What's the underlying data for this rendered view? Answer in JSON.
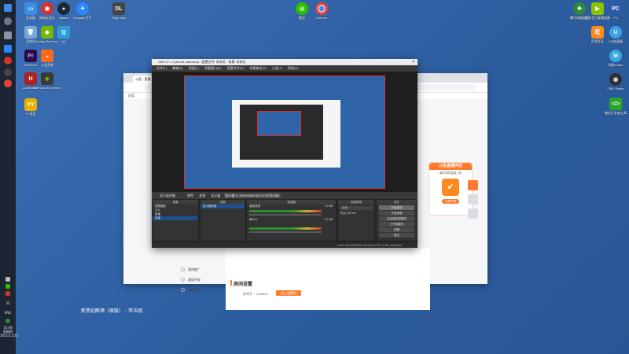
{
  "taskbar": {
    "tray_lang": "ENG",
    "clock_time": "10:48",
    "clock_weekday": "星期四",
    "clock_date": "2021/11/25",
    "tray_num": "35"
  },
  "desktop_left": [
    {
      "label": "此电脑",
      "icon": "computer-icon",
      "color": "#3a8ee6"
    },
    {
      "label": "网易云音乐",
      "icon": "netease-music-icon",
      "color": "#d7322c"
    },
    {
      "label": "Steam",
      "icon": "steam-icon",
      "color": "#1b2838"
    },
    {
      "label": "Dingtalk 钉钉",
      "icon": "dingtalk-icon",
      "color": "#2d88ff"
    },
    {
      "label": "Ding Light",
      "icon": "dl-icon",
      "color": "#444444"
    },
    {
      "label": "回收站",
      "icon": "recycle-bin-icon",
      "color": "#7aa7d8"
    },
    {
      "label": "Nvidia GeForce",
      "icon": "nvidia-icon",
      "color": "#76b900"
    },
    {
      "label": "QQ",
      "icon": "qq-icon",
      "color": "#2d9cdb"
    },
    {
      "label": "Premiere",
      "icon": "premiere-icon",
      "color": "#2a0d4a"
    },
    {
      "label": "斗鱼直播",
      "icon": "douyu-icon",
      "color": "#ff6a1a"
    },
    {
      "label": "AutoHotkey",
      "icon": "autohotkey-icon",
      "color": "#b02222"
    },
    {
      "label": "GeForce Experience",
      "icon": "geforce-icon",
      "color": "#3a3a3a"
    },
    {
      "label": "YY语音",
      "icon": "yy-icon",
      "color": "#e8b000"
    }
  ],
  "desktop_center": [
    {
      "label": "微信",
      "icon": "wechat-icon",
      "color": "#2dc100"
    },
    {
      "label": "Chrome",
      "icon": "chrome-icon",
      "color": "#e94235"
    }
  ],
  "desktop_right": [
    {
      "label": "腾讯电脑管家",
      "icon": "tencent-guard-icon",
      "color": "#2a8a3a"
    },
    {
      "label": "爱奇艺万能播放器",
      "icon": "iqiyi-icon",
      "color": "#8ac400"
    },
    {
      "label": "PC",
      "icon": "pc-icon",
      "color": "#2a5aa8"
    },
    {
      "label": "阿里旺旺",
      "icon": "aliwangwang-icon",
      "color": "#ff8a1a"
    },
    {
      "label": "UU加速器",
      "icon": "uu-icon",
      "color": "#3aa0e8"
    },
    {
      "label": "网易MuMu",
      "icon": "mumu-icon",
      "color": "#38a8e0"
    },
    {
      "label": "OBS Studio",
      "icon": "obs-icon",
      "color": "#302e31"
    },
    {
      "label": "微信开发者工具",
      "icon": "wechat-dev-icon",
      "color": "#2aa52a"
    }
  ],
  "browser": {
    "tab_title": "斗鱼 - 直播",
    "bookmark": "应用",
    "menu_items": [
      "我的推广",
      "超级开放",
      "直播伴侣"
    ],
    "section_title": "房间设置",
    "room_label": "房间号：",
    "room_id": "3785429",
    "room_button": "进入直播间",
    "promo_title": "斗鱼直播伴侣",
    "promo_sub": "最好用的直播工具",
    "promo_button": "立即下载"
  },
  "obs": {
    "title": "OBS 27.1.3 (64-bit, windows) - 配置文件: 未命名 - 场景: 未命名",
    "menu": [
      "文件(F)",
      "编辑(E)",
      "视图(V)",
      "停靠窗口(D)",
      "配置文件(P)",
      "场景集合(S)",
      "工具(T)",
      "帮助(H)"
    ],
    "source_bar": "显示器采集",
    "source_bar_props": "属性",
    "source_bar_filter": "滤镜",
    "display_label": "显示器",
    "display_value": "显示器 1: 1920x1080 @ 0,0 (主显示器)",
    "capture_mode_value": "自动",
    "panels": {
      "scenes_header": "场景",
      "scenes": [
        "视频播放",
        "LOL",
        "直播",
        "直播"
      ],
      "sources_header": "来源",
      "sources": [
        "显示器采集"
      ],
      "mixer_header": "混音器",
      "mixer_track1": "桌面音频",
      "mixer_track1_db": "0.0 dB",
      "mixer_track2": "麦/Aux",
      "mixer_track2_db": "0.0 dB",
      "transition_header": "场景转场",
      "transition_value": "淡出",
      "duration_label": "时长",
      "duration_value": "300 ms",
      "controls_header": "控件",
      "controls": [
        "开始推流",
        "开始录制",
        "启动虚拟摄像机",
        "工作室模式",
        "设置",
        "退出"
      ]
    },
    "status": "LIVE: 00:00:00   REC: 00:00:00   CPU: 0.4%, 30.00 fps"
  },
  "now_playing": "新贵妃醉酒（原版） - 李玉刚"
}
